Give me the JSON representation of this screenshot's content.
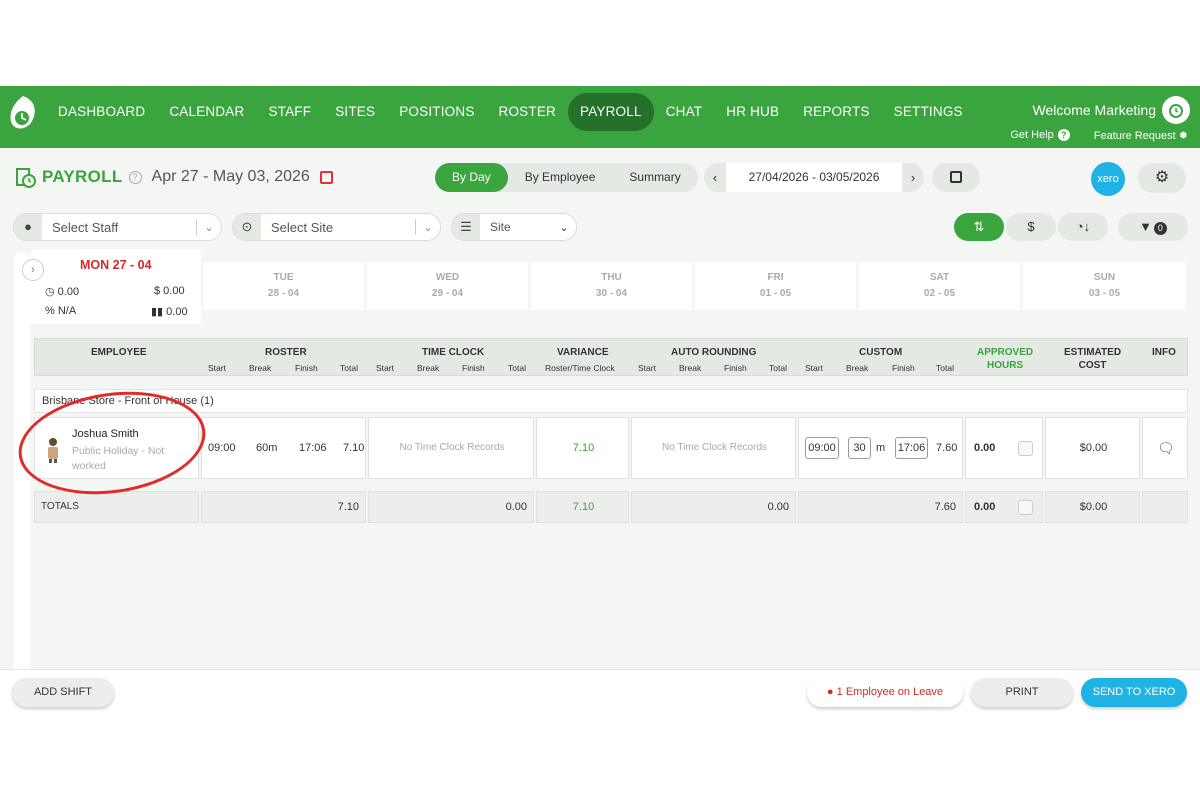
{
  "nav": {
    "items": [
      "DASHBOARD",
      "CALENDAR",
      "STAFF",
      "SITES",
      "POSITIONS",
      "ROSTER",
      "PAYROLL",
      "CHAT",
      "HR HUB",
      "REPORTS",
      "SETTINGS"
    ],
    "active": "PAYROLL",
    "welcome": "Welcome Marketing",
    "get_help": "Get Help",
    "feature_request": "Feature Request"
  },
  "header": {
    "title": "PAYROLL",
    "date_range": "Apr 27 - May 03, 2026",
    "view_tabs": [
      "By Day",
      "By Employee",
      "Summary"
    ],
    "active_tab": "By Day",
    "date_value": "27/04/2026 - 03/05/2026",
    "xero_label": "xero"
  },
  "filters": {
    "staff_placeholder": "Select Staff",
    "site_placeholder": "Select Site",
    "group_by": "Site",
    "filter_count": "0"
  },
  "days": {
    "active": {
      "label": "MON 27 - 04",
      "hours": "0.00",
      "cost": "$ 0.00",
      "percent": "N/A",
      "chart_value": "0.00"
    },
    "others": [
      {
        "name": "TUE",
        "date": "28 - 04"
      },
      {
        "name": "WED",
        "date": "29 - 04"
      },
      {
        "name": "THU",
        "date": "30 - 04"
      },
      {
        "name": "FRI",
        "date": "01 - 05"
      },
      {
        "name": "SAT",
        "date": "02 - 05"
      },
      {
        "name": "SUN",
        "date": "03 - 05"
      }
    ]
  },
  "table": {
    "headers": {
      "employee": "EMPLOYEE",
      "roster": "ROSTER",
      "time_clock": "TIME CLOCK",
      "variance": "VARIANCE",
      "variance_sub": "Roster/Time Clock",
      "auto_rounding": "AUTO ROUNDING",
      "custom": "CUSTOM",
      "approved": "APPROVED",
      "hours": "HOURS",
      "estimated": "ESTIMATED",
      "cost": "COST",
      "info": "INFO",
      "sub": [
        "Start",
        "Break",
        "Finish",
        "Total"
      ]
    },
    "group": "Brisbane Store - Front of House (1)",
    "row": {
      "name": "Joshua Smith",
      "status": "Public Holiday - Not worked",
      "roster_start": "09:00",
      "roster_break": "60m",
      "roster_finish": "17:06",
      "roster_total": "7.10",
      "time_clock": "No Time Clock Records",
      "variance": "7.10",
      "auto_rounding": "No Time Clock Records",
      "custom_start": "09:00",
      "custom_break": "30",
      "custom_break_unit": "m",
      "custom_finish": "17:06",
      "custom_total": "7.60",
      "approved": "0.00",
      "cost": "$0.00"
    },
    "totals": {
      "label": "TOTALS",
      "roster": "7.10",
      "time_clock": "0.00",
      "variance": "7.10",
      "auto_rounding": "0.00",
      "custom": "7.60",
      "approved": "0.00",
      "cost": "$0.00"
    }
  },
  "bottom": {
    "add_shift": "ADD SHIFT",
    "leave": "1 Employee on Leave",
    "print": "PRINT",
    "send": "SEND TO XERO"
  },
  "colors": {
    "brand": "#3aa43e",
    "nav_active": "#25702a",
    "alert": "#d32a2a",
    "xero": "#1fb3e4"
  }
}
